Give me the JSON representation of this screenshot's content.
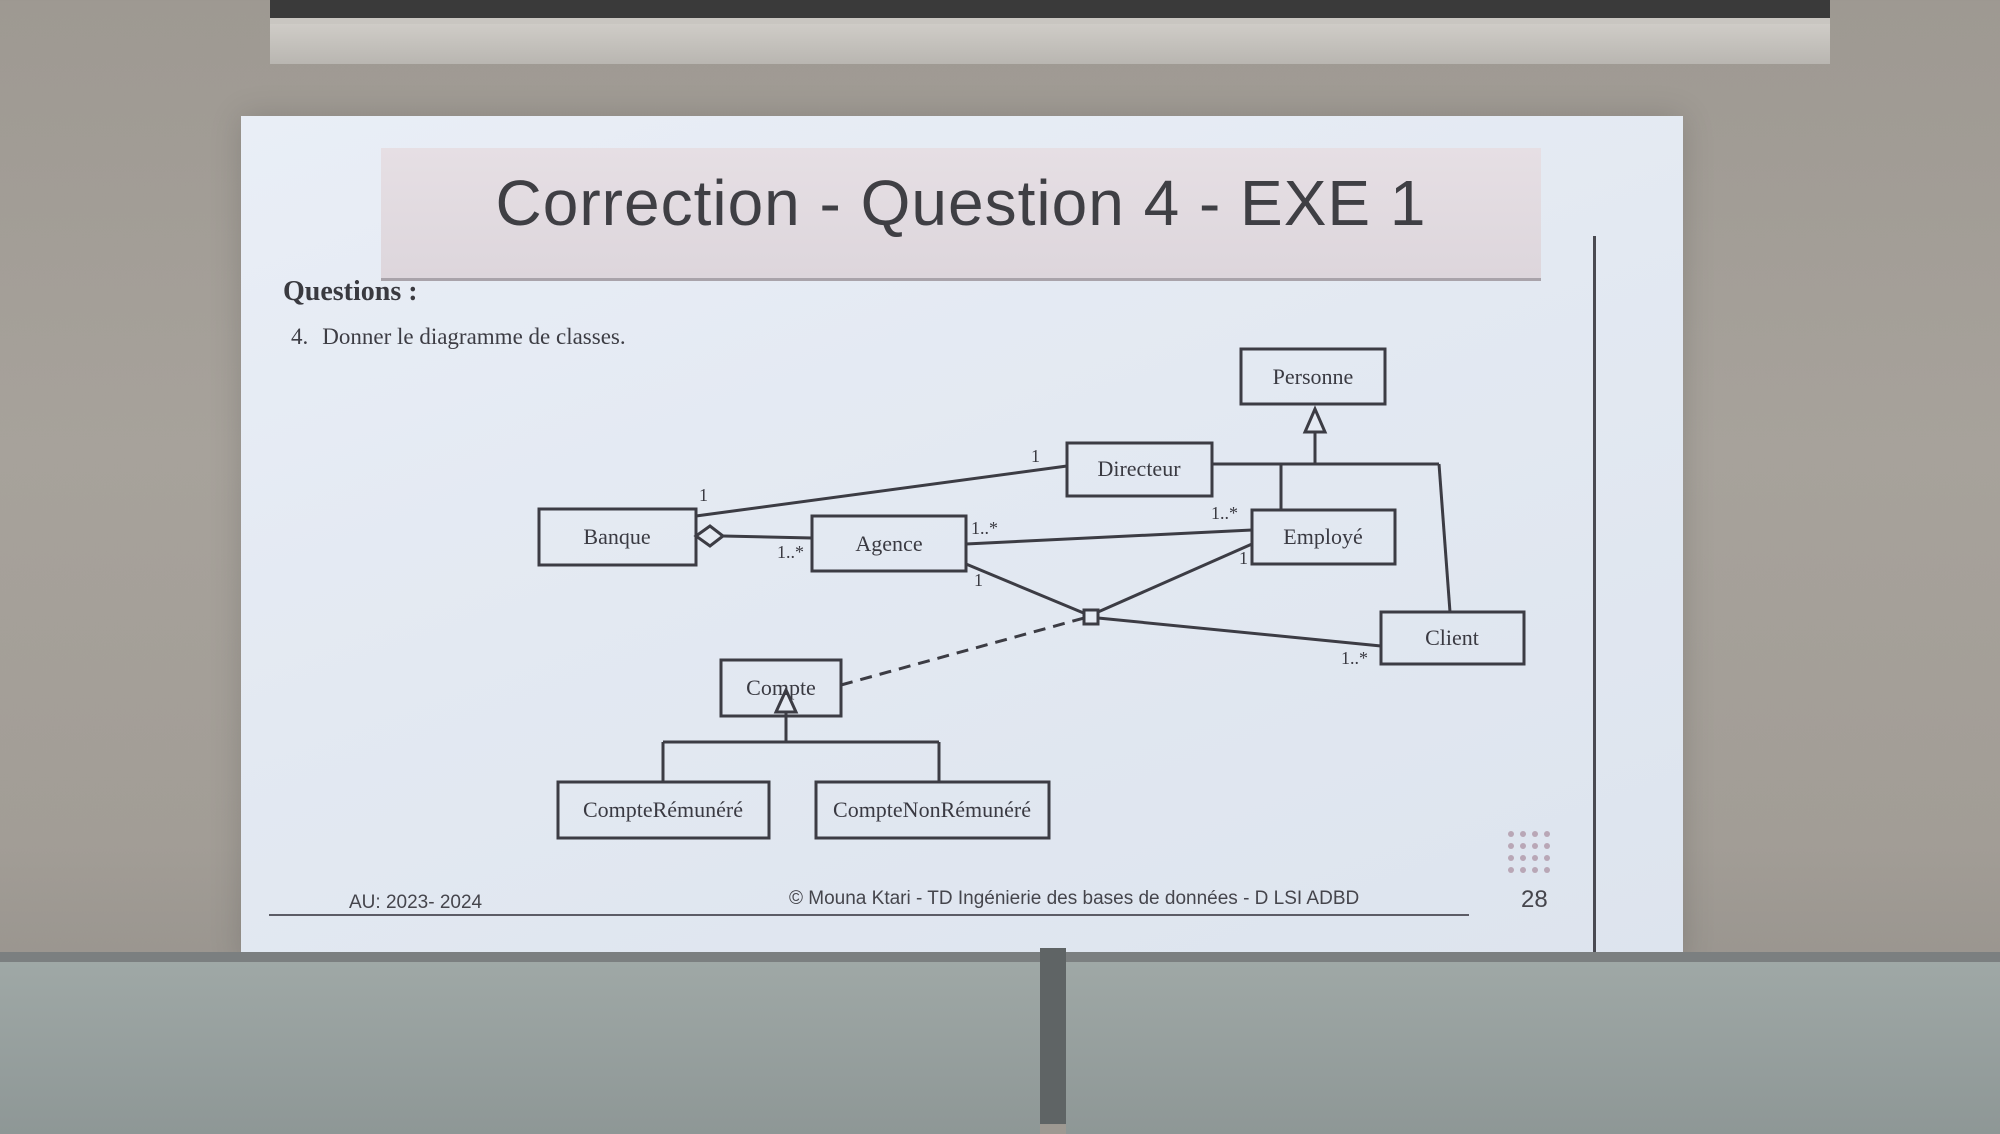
{
  "slide": {
    "title": "Correction - Question 4 - EXE 1",
    "questions_heading": "Questions :",
    "question_number": "4.",
    "question_text": "Donner le diagramme de classes.",
    "footer_left": "AU: 2023- 2024",
    "footer_center": "© Mouna Ktari - TD Ingénierie des bases de données  - D LSI ADBD",
    "page_number": "28"
  },
  "diagram": {
    "classes": {
      "personne": "Personne",
      "directeur": "Directeur",
      "banque": "Banque",
      "agence": "Agence",
      "employe": "Employé",
      "client": "Client",
      "compte": "Compte",
      "compte_remunere": "CompteRémunéré",
      "compte_non_remunere": "CompteNonRémunéré"
    },
    "multiplicities": {
      "banque_directeur_banque": "1",
      "banque_directeur_directeur": "1",
      "banque_agence_agence": "1..*",
      "agence_employe_agence": "1..*",
      "agence_employe_employe": "1..*",
      "ternary_agence": "1",
      "ternary_employe": "1",
      "ternary_client": "1..*"
    }
  }
}
